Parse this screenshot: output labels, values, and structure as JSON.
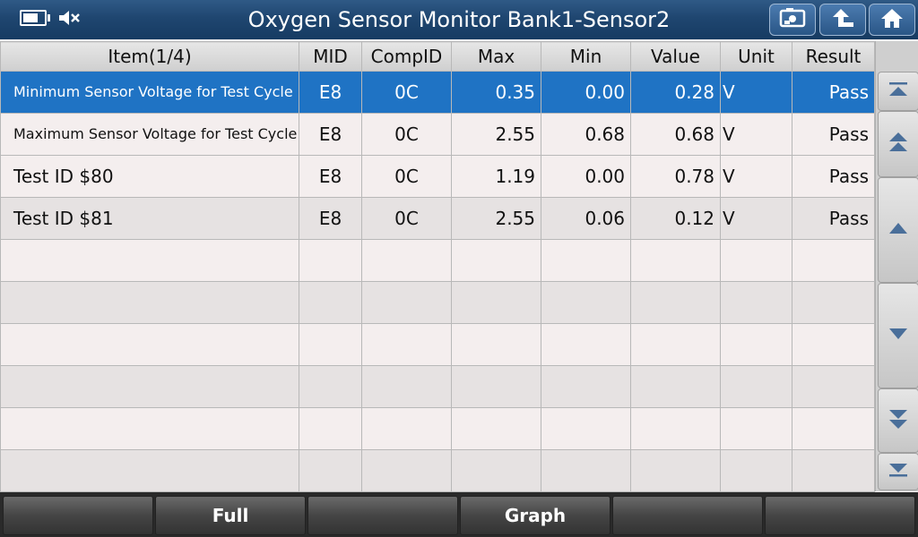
{
  "header": {
    "title": "Oxygen Sensor Monitor Bank1-Sensor2",
    "icons": [
      "battery-icon",
      "speaker-muted-icon",
      "screenshot-icon",
      "back-icon",
      "home-icon"
    ]
  },
  "table": {
    "columns": [
      "Item(1/4)",
      "MID",
      "CompID",
      "Max",
      "Min",
      "Value",
      "Unit",
      "Result"
    ],
    "rows": [
      {
        "item": "Minimum Sensor Voltage for Test Cycle",
        "mid": "E8",
        "compid": "0C",
        "max": "0.35",
        "min": "0.00",
        "value": "0.28",
        "unit": "V",
        "result": "Pass"
      },
      {
        "item": "Maximum Sensor Voltage for Test Cycle",
        "mid": "E8",
        "compid": "0C",
        "max": "2.55",
        "min": "0.68",
        "value": "0.68",
        "unit": "V",
        "result": "Pass"
      },
      {
        "item": "Test ID $80",
        "mid": "E8",
        "compid": "0C",
        "max": "1.19",
        "min": "0.00",
        "value": "0.78",
        "unit": "V",
        "result": "Pass"
      },
      {
        "item": "Test ID $81",
        "mid": "E8",
        "compid": "0C",
        "max": "2.55",
        "min": "0.06",
        "value": "0.12",
        "unit": "V",
        "result": "Pass"
      }
    ],
    "selected_row": 0
  },
  "scroll": {
    "icons": [
      "scroll-top-icon",
      "page-up-icon",
      "line-up-icon",
      "line-down-icon",
      "page-down-icon",
      "scroll-bottom-icon"
    ]
  },
  "footer": {
    "buttons": [
      "",
      "Full",
      "",
      "Graph",
      "",
      ""
    ]
  },
  "colors": {
    "title_bar": "#1f4670",
    "selected_row": "#1f73c4"
  }
}
